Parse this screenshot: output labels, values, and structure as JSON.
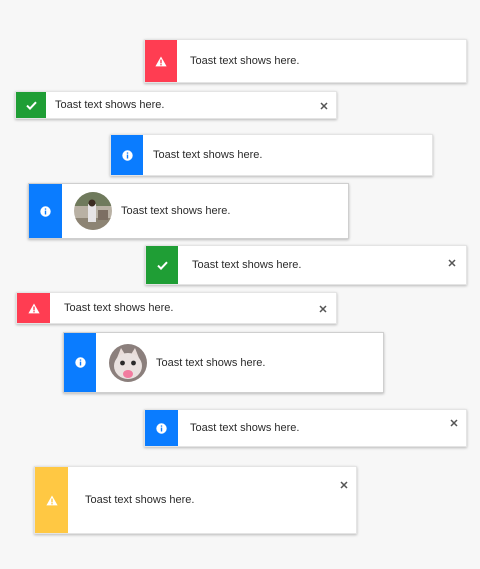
{
  "colors": {
    "error": "#ff3d52",
    "success": "#1f9e35",
    "info": "#0a7cff",
    "warning": "#ffc843"
  },
  "toasts": [
    {
      "kind": "error",
      "icon": "warning-triangle-icon",
      "text": "Toast text shows here.",
      "closable": false,
      "avatar": false
    },
    {
      "kind": "success",
      "icon": "checkmark-icon",
      "text": "Toast text shows here.",
      "closable": true,
      "avatar": false
    },
    {
      "kind": "info",
      "icon": "info-circle-icon",
      "text": "Toast text shows here.",
      "closable": false,
      "avatar": false
    },
    {
      "kind": "info",
      "icon": "info-circle-icon",
      "text": "Toast text shows here.",
      "closable": false,
      "avatar": true
    },
    {
      "kind": "success",
      "icon": "checkmark-icon",
      "text": "Toast text shows here.",
      "closable": true,
      "avatar": false
    },
    {
      "kind": "error",
      "icon": "warning-triangle-icon",
      "text": "Toast text shows here.",
      "closable": true,
      "avatar": false
    },
    {
      "kind": "info",
      "icon": "info-circle-icon",
      "text": "Toast text shows here.",
      "closable": false,
      "avatar": true
    },
    {
      "kind": "info",
      "icon": "info-circle-icon",
      "text": "Toast text shows here.",
      "closable": true,
      "avatar": false
    },
    {
      "kind": "warning",
      "icon": "warning-triangle-icon",
      "text": "Toast text shows here.",
      "closable": true,
      "avatar": false
    }
  ]
}
